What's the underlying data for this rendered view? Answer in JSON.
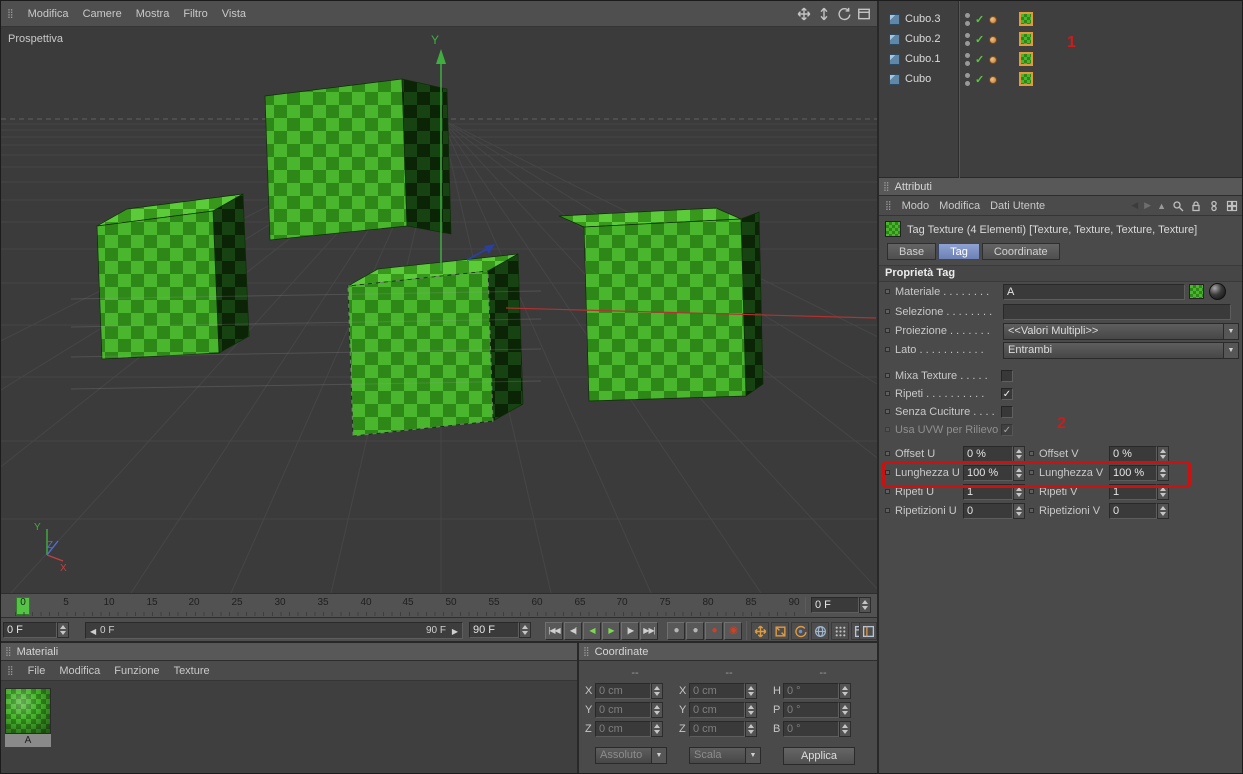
{
  "colors": {
    "accent_green": "#49b62e",
    "dark_green": "#2e8818",
    "annotation_red": "#cc1111",
    "tab_active_blue": "#7c90c2",
    "check_green": "#58c93a",
    "tag_border_orange": "#e09a3a"
  },
  "icons": {
    "grip": "⣿",
    "back": "◀",
    "forward": "▶",
    "up": "▲",
    "dropdown": "▼",
    "slider_left": "◀",
    "slider_right": "▶"
  },
  "viewport_menu": {
    "items": [
      "Modifica",
      "Camere",
      "Mostra",
      "Filtro",
      "Vista"
    ]
  },
  "viewport": {
    "view_label": "Prospettiva",
    "axis_y": "Y",
    "gizmo_x": "X",
    "gizmo_y": "Y",
    "gizmo_z": "Z"
  },
  "timeline": {
    "ticks": [
      "0",
      "5",
      "10",
      "15",
      "20",
      "25",
      "30",
      "35",
      "40",
      "45",
      "50",
      "55",
      "60",
      "65",
      "70",
      "75",
      "80",
      "85",
      "90"
    ],
    "ruler_frame": "0 F",
    "transport_frame": "0 F",
    "range_start": "0 F",
    "range_end": "90 F",
    "end_frame": "90 F",
    "buttons": {
      "go_start": "|◀◀",
      "prev_key": "◀|",
      "play_back": "◀",
      "play": "▶",
      "next_frame": "|▶",
      "go_end": "▶▶|"
    },
    "records": {
      "a": "●",
      "b": "●",
      "c": "●",
      "d": "◉"
    }
  },
  "materials_panel": {
    "title": "Materiali",
    "menu": [
      "File",
      "Modifica",
      "Funzione",
      "Texture"
    ],
    "material_name": "A"
  },
  "coordinates_panel": {
    "title": "Coordinate",
    "headers": [
      "--",
      "--",
      "--"
    ],
    "rows": [
      {
        "l1": "X",
        "v1": "0 cm",
        "l2": "X",
        "v2": "0 cm",
        "l3": "H",
        "v3": "0 °"
      },
      {
        "l1": "Y",
        "v1": "0 cm",
        "l2": "Y",
        "v2": "0 cm",
        "l3": "P",
        "v3": "0 °"
      },
      {
        "l1": "Z",
        "v1": "0 cm",
        "l2": "Z",
        "v2": "0 cm",
        "l3": "B",
        "v3": "0 °"
      }
    ],
    "mode": "Assoluto",
    "scale": "Scala",
    "apply": "Applica"
  },
  "object_manager": {
    "objects": [
      "Cubo.3",
      "Cubo.2",
      "Cubo.1",
      "Cubo"
    ]
  },
  "attributes": {
    "title": "Attributi",
    "menu": [
      "Modo",
      "Modifica",
      "Dati Utente"
    ],
    "object_header": "Tag Texture (4 Elementi) [Texture, Texture, Texture, Texture]",
    "tabs": [
      "Base",
      "Tag",
      "Coordinate"
    ],
    "section": "Proprietà Tag",
    "materiale_label": "Materiale . . . . . . . .",
    "materiale_value": "A",
    "selezione_label": "Selezione . . . . . . . .",
    "proiezione_label": "Proiezione . . . . . . .",
    "proiezione_value": "<<Valori Multipli>>",
    "lato_label": "Lato . . . . . . . . . . .",
    "lato_value": "Entrambi",
    "mixa_label": "Mixa Texture . . . . .",
    "ripeti_label": "Ripeti . . . . . . . . . .",
    "senza_label": "Senza Cuciture . . . .",
    "uvw_label": "Usa UVW per Rilievo",
    "grid": [
      {
        "l1": "Offset U",
        "v1": "0 %",
        "l2": "Offset V",
        "v2": "0 %"
      },
      {
        "l1": "Lunghezza U",
        "v1": "100 %",
        "l2": "Lunghezza V",
        "v2": "100 %"
      },
      {
        "l1": "Ripeti U",
        "v1": "1",
        "l2": "Ripeti V",
        "v2": "1"
      },
      {
        "l1": "Ripetizioni U",
        "v1": "0",
        "l2": "Ripetizioni V",
        "v2": "0"
      }
    ]
  },
  "annotations": {
    "one": "1",
    "two": "2"
  }
}
